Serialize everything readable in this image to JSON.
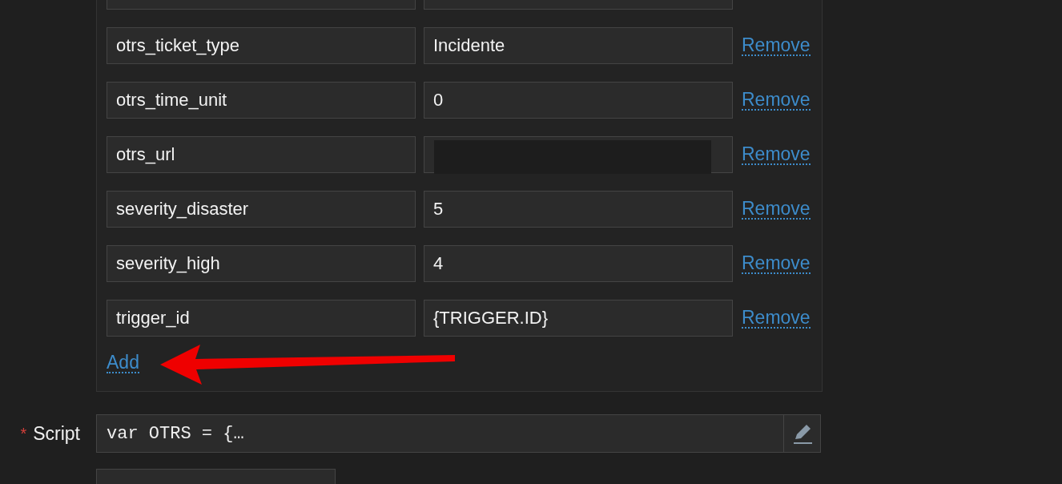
{
  "macros": [
    {
      "name": "otrs_ticket_type",
      "value": "Incidente",
      "redacted": false,
      "action": "Remove"
    },
    {
      "name": "otrs_time_unit",
      "value": "0",
      "redacted": false,
      "action": "Remove"
    },
    {
      "name": "otrs_url",
      "redacted": true,
      "action": "Remove"
    },
    {
      "name": "severity_disaster",
      "value": "5",
      "redacted": false,
      "action": "Remove"
    },
    {
      "name": "severity_high",
      "value": "4",
      "redacted": false,
      "action": "Remove"
    },
    {
      "name": "trigger_id",
      "value": "{TRIGGER.ID}",
      "redacted": false,
      "action": "Remove"
    }
  ],
  "add_link": "Add",
  "script": {
    "required_mark": "*",
    "label": "Script",
    "value": "var OTRS = {…"
  }
}
